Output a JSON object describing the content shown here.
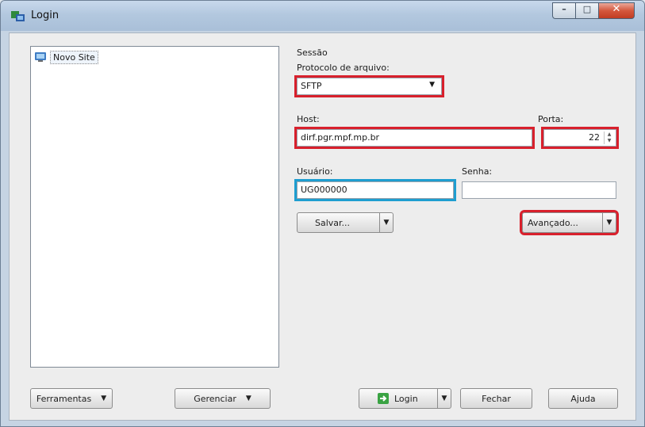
{
  "window": {
    "title": "Login"
  },
  "site_tree": {
    "items": [
      {
        "label": "Novo Site"
      }
    ]
  },
  "session": {
    "group_label": "Sessão",
    "protocol_label": "Protocolo de arquivo:",
    "protocol_value": "SFTP",
    "host_label": "Host:",
    "host_value": "dirf.pgr.mpf.mp.br",
    "port_label": "Porta:",
    "port_value": "22",
    "user_label": "Usuário:",
    "user_value": "UG000000",
    "password_label": "Senha:",
    "password_value": "",
    "save_label": "Salvar...",
    "advanced_label": "Avançado..."
  },
  "bottom": {
    "tools_label": "Ferramentas",
    "manage_label": "Gerenciar",
    "login_label": "Login",
    "close_label": "Fechar",
    "help_label": "Ajuda"
  },
  "colors": {
    "highlight_red": "#d8202c",
    "highlight_blue": "#1e9ed0"
  }
}
